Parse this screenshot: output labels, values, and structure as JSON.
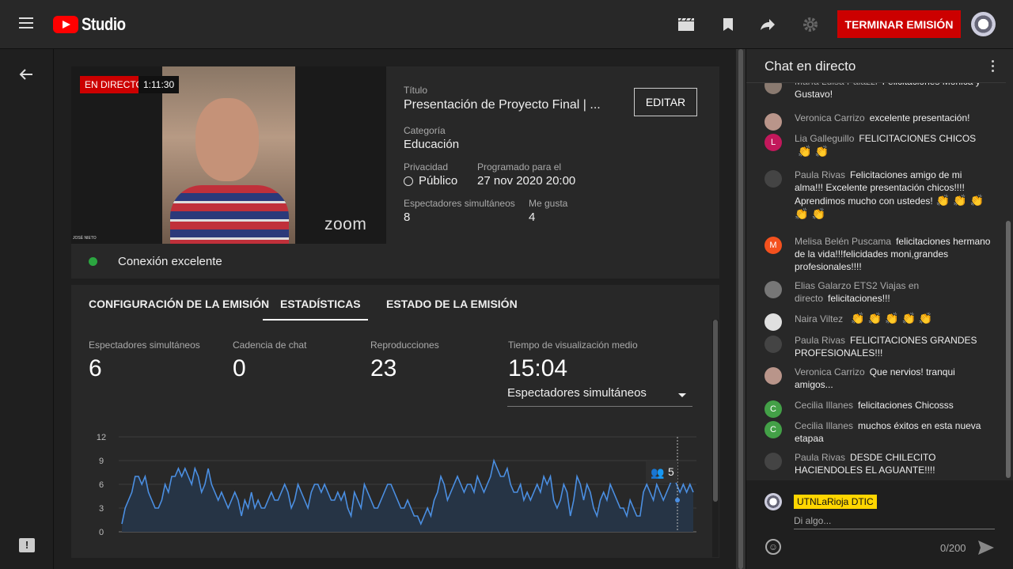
{
  "header": {
    "app_name": "Studio",
    "end_button": "TERMINAR EMISIÓN"
  },
  "stream": {
    "live_badge": "EN DIRECTO",
    "elapsed": "1:11:30",
    "zoom_watermark": "zoom",
    "name_tag": "JOSÉ NIETO",
    "connection": "Conexión excelente",
    "connection_color": "#2ba640",
    "title_label": "Título",
    "title": "Presentación de Proyecto Final | ...",
    "edit_button": "EDITAR",
    "category_label": "Categoría",
    "category": "Educación",
    "privacy_label": "Privacidad",
    "privacy": "Público",
    "scheduled_label": "Programado para el",
    "scheduled": "27 nov 2020 20:00",
    "viewers_label": "Espectadores simultáneos",
    "viewers": "8",
    "likes_label": "Me gusta",
    "likes": "4"
  },
  "tabs": [
    "CONFIGURACIÓN DE LA EMISIÓN",
    "ESTADÍSTICAS",
    "ESTADO DE LA EMISIÓN"
  ],
  "stats": [
    {
      "label": "Espectadores simultáneos",
      "value": "6"
    },
    {
      "label": "Cadencia de chat",
      "value": "0"
    },
    {
      "label": "Reproducciones",
      "value": "23"
    },
    {
      "label": "Tiempo de visualización medio",
      "value": "15:04"
    }
  ],
  "metric_select": "Espectadores simultáneos",
  "chart_data": {
    "type": "area",
    "ylim": [
      0,
      12
    ],
    "yticks": [
      "0",
      "3",
      "6",
      "9",
      "12"
    ],
    "values": [
      1,
      3,
      4,
      5,
      7,
      7,
      6,
      7,
      5,
      4,
      3,
      3,
      4,
      6,
      5,
      7,
      7,
      8,
      7,
      8,
      7,
      6,
      8,
      7,
      5,
      6,
      8,
      6,
      5,
      4,
      5,
      4,
      3,
      4,
      5,
      4,
      2,
      4,
      3,
      5,
      3,
      4,
      3,
      3,
      4,
      5,
      4,
      4,
      5,
      6,
      5,
      3,
      4,
      6,
      5,
      4,
      3,
      5,
      6,
      6,
      5,
      6,
      5,
      4,
      4,
      5,
      4,
      5,
      3,
      2,
      5,
      4,
      3,
      6,
      5,
      4,
      3,
      3,
      4,
      5,
      6,
      6,
      5,
      4,
      3,
      3,
      4,
      3,
      2,
      2,
      1,
      2,
      3,
      2,
      4,
      5,
      7,
      6,
      4,
      5,
      6,
      7,
      6,
      5,
      6,
      6,
      5,
      7,
      6,
      5,
      6,
      7,
      9,
      8,
      7,
      7,
      8,
      6,
      5,
      5,
      6,
      4,
      5,
      4,
      5,
      6,
      5,
      7,
      6,
      7,
      4,
      3,
      4,
      6,
      5,
      2,
      4,
      7,
      6,
      4,
      6,
      5,
      3,
      2,
      4,
      5,
      4,
      6,
      5,
      4,
      3,
      3,
      2,
      4,
      3,
      2,
      2,
      5,
      6,
      5,
      4,
      6,
      5,
      4,
      5,
      6,
      7,
      6,
      5,
      6,
      5,
      6,
      5
    ],
    "tooltip": "5",
    "fill_color": "#263445",
    "line_color": "#4b8fe2"
  },
  "chat": {
    "title": "Chat en directo",
    "messages": [
      {
        "author": "María Luisa Palazzi",
        "text": "Felicitaciones Mónica y Gustavo!",
        "claps": 0,
        "avatar": "",
        "color": "#8a7a70"
      },
      {
        "author": "Veronica Carrizo",
        "text": "excelente presentación!",
        "claps": 0,
        "avatar": "",
        "color": "#b9958a"
      },
      {
        "author": "Lia Galleguillo",
        "text": "FELICITACIONES CHICOS",
        "claps": 2,
        "avatar": "L",
        "color": "#c2185b"
      },
      {
        "author": "Paula Rivas",
        "text": "Felicitaciones amigo de mi alma!!! Excelente presentación chicos!!!! Aprendimos mucho con ustedes!",
        "claps": 5,
        "avatar": "",
        "color": "#444444"
      },
      {
        "author": "Melisa Belén Puscama",
        "text": "felicitaciones hermano de la vida!!!felicidades moni,grandes profesionales!!!!",
        "claps": 0,
        "avatar": "M",
        "color": "#f4511e"
      },
      {
        "author": "Elias Galarzo ETS2 Viajas en directo",
        "text": "felicitaciones!!!",
        "claps": 0,
        "avatar": "",
        "color": "#777777"
      },
      {
        "author": "Naira Viltez",
        "text": "",
        "claps": 5,
        "avatar": "",
        "color": "#e0e0e0"
      },
      {
        "author": "Paula Rivas",
        "text": "FELICITACIONES GRANDES PROFESIONALES!!!",
        "claps": 0,
        "avatar": "",
        "color": "#444444"
      },
      {
        "author": "Veronica Carrizo",
        "text": "Que nervios! tranqui amigos...",
        "claps": 0,
        "avatar": "",
        "color": "#b9958a"
      },
      {
        "author": "Cecilia Illanes",
        "text": "felicitaciones Chicosss",
        "claps": 0,
        "avatar": "C",
        "color": "#43a047"
      },
      {
        "author": "Cecilia Illanes",
        "text": "muchos éxitos en esta nueva etapaa",
        "claps": 0,
        "avatar": "C",
        "color": "#43a047"
      },
      {
        "author": "Paula Rivas",
        "text": "DESDE CHILECITO HACIENDOLES EL AGUANTE!!!!",
        "claps": 0,
        "avatar": "",
        "color": "#444444"
      }
    ],
    "user": "UTNLaRioja DTIC",
    "placeholder": "Di algo...",
    "counter": "0/200"
  }
}
